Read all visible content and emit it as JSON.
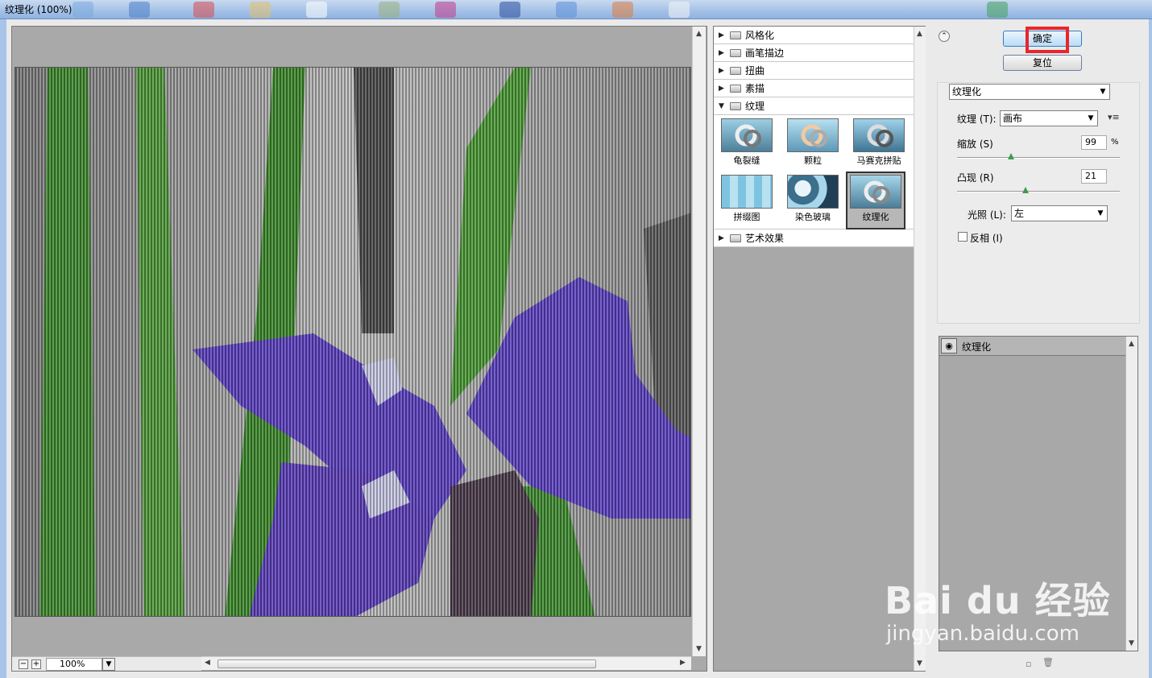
{
  "window": {
    "title": "纹理化 (100%)"
  },
  "preview": {
    "zoom_value": "100%"
  },
  "filter_gallery": {
    "categories": [
      {
        "label": "风格化",
        "expanded": false
      },
      {
        "label": "画笔描边",
        "expanded": false
      },
      {
        "label": "扭曲",
        "expanded": false
      },
      {
        "label": "素描",
        "expanded": false
      },
      {
        "label": "纹理",
        "expanded": true
      },
      {
        "label": "艺术效果",
        "expanded": false
      }
    ],
    "texture_filters": [
      "龟裂缝",
      "颗粒",
      "马赛克拼贴",
      "拼缀图",
      "染色玻璃",
      "纹理化"
    ],
    "selected_filter": "纹理化"
  },
  "options": {
    "ok_label": "确定",
    "reset_label": "复位",
    "filter_select": "纹理化",
    "texture_label": "纹理 (T):",
    "texture_value": "画布",
    "scaling_label": "缩放 (S)",
    "scaling_value": "99",
    "scaling_unit": "%",
    "scaling_fraction": 0.33,
    "relief_label": "凸现 (R)",
    "relief_value": "21",
    "relief_fraction": 0.42,
    "light_label": "光照 (L):",
    "light_value": "左",
    "invert_label": "反相 (I)",
    "invert_checked": false
  },
  "effect_layers": {
    "items": [
      "纹理化"
    ]
  },
  "watermark": {
    "logo_text": "Bai du 经验",
    "url": "jingyan.baidu.com"
  },
  "colors": {
    "highlight": "#e8262b",
    "panel_gray": "#a8a8a8"
  }
}
